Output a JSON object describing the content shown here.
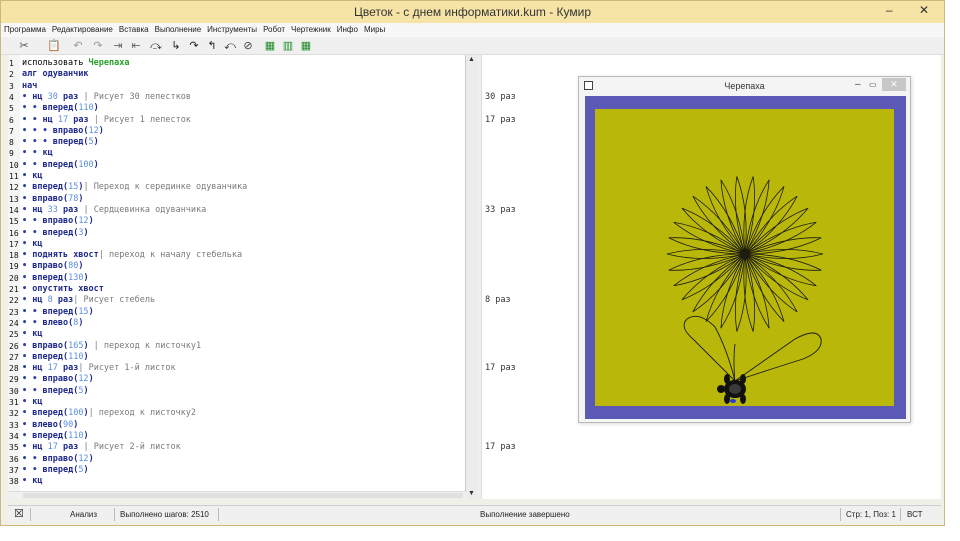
{
  "window": {
    "title": "Цветок - с днем информатики.kum - Кумир",
    "minimize": "–",
    "close": "✕"
  },
  "menu": [
    "Программа",
    "Редактирование",
    "Вставка",
    "Выполнение",
    "Инструменты",
    "Робот",
    "Чертежник",
    "Инфо",
    "Миры"
  ],
  "toolbar_icons": [
    "cut-icon",
    "paste-icon",
    "undo-icon",
    "redo-icon",
    "indent-icon",
    "unindent-icon",
    "step-icon",
    "step-in-icon",
    "step-over-icon",
    "step-out-icon",
    "return-icon",
    "stop-icon",
    "grid-one-icon",
    "grid-two-icon",
    "grid-four-icon"
  ],
  "code": [
    {
      "n": "1",
      "parts": [
        [
          "plain",
          "использовать "
        ],
        [
          "mod",
          "Черепаха"
        ]
      ]
    },
    {
      "n": "2",
      "parts": [
        [
          "kw",
          "алг одуванчик"
        ]
      ]
    },
    {
      "n": "3",
      "parts": [
        [
          "kw",
          "нач"
        ]
      ]
    },
    {
      "n": "4",
      "parts": [
        [
          "dot",
          "• "
        ],
        [
          "kw",
          "нц "
        ],
        [
          "num",
          "30"
        ],
        [
          "kw",
          " раз"
        ],
        [
          "cmt",
          " | Рисует 30 лепестков"
        ]
      ]
    },
    {
      "n": "5",
      "parts": [
        [
          "dot",
          "• • "
        ],
        [
          "kw",
          "вперед("
        ],
        [
          "num",
          "110"
        ],
        [
          "kw",
          ")"
        ]
      ]
    },
    {
      "n": "6",
      "parts": [
        [
          "dot",
          "• • "
        ],
        [
          "kw",
          "нц "
        ],
        [
          "num",
          "17"
        ],
        [
          "kw",
          " раз"
        ],
        [
          "cmt",
          " | Рисует 1 лепесток"
        ]
      ]
    },
    {
      "n": "7",
      "parts": [
        [
          "dot",
          "• • • "
        ],
        [
          "kw",
          "вправо("
        ],
        [
          "num",
          "12"
        ],
        [
          "kw",
          ")"
        ]
      ]
    },
    {
      "n": "8",
      "parts": [
        [
          "dot",
          "• • • "
        ],
        [
          "kw",
          "вперед("
        ],
        [
          "num",
          "5"
        ],
        [
          "kw",
          ")"
        ]
      ]
    },
    {
      "n": "9",
      "parts": [
        [
          "dot",
          "• • "
        ],
        [
          "kw",
          "кц"
        ]
      ]
    },
    {
      "n": "10",
      "parts": [
        [
          "dot",
          "• • "
        ],
        [
          "kw",
          "вперед("
        ],
        [
          "num",
          "100"
        ],
        [
          "kw",
          ")"
        ]
      ]
    },
    {
      "n": "11",
      "parts": [
        [
          "dot",
          "• "
        ],
        [
          "kw",
          "кц"
        ]
      ]
    },
    {
      "n": "12",
      "parts": [
        [
          "dot",
          "• "
        ],
        [
          "kw",
          "вперед("
        ],
        [
          "num",
          "15"
        ],
        [
          "kw",
          ")"
        ],
        [
          "cmt",
          "| Переход к серединке одуванчика"
        ]
      ]
    },
    {
      "n": "13",
      "parts": [
        [
          "dot",
          "• "
        ],
        [
          "kw",
          "вправо("
        ],
        [
          "num",
          "78"
        ],
        [
          "kw",
          ")"
        ]
      ]
    },
    {
      "n": "14",
      "parts": [
        [
          "dot",
          "• "
        ],
        [
          "kw",
          "нц "
        ],
        [
          "num",
          "33"
        ],
        [
          "kw",
          " раз"
        ],
        [
          "cmt",
          " | Сердцевинка одуванчика"
        ]
      ]
    },
    {
      "n": "15",
      "parts": [
        [
          "dot",
          "• • "
        ],
        [
          "kw",
          "вправо("
        ],
        [
          "num",
          "12"
        ],
        [
          "kw",
          ")"
        ]
      ]
    },
    {
      "n": "16",
      "parts": [
        [
          "dot",
          "• • "
        ],
        [
          "kw",
          "вперед("
        ],
        [
          "num",
          "3"
        ],
        [
          "kw",
          ")"
        ]
      ]
    },
    {
      "n": "17",
      "parts": [
        [
          "dot",
          "• "
        ],
        [
          "kw",
          "кц"
        ]
      ]
    },
    {
      "n": "18",
      "parts": [
        [
          "dot",
          "• "
        ],
        [
          "kw",
          "поднять хвост"
        ],
        [
          "cmt",
          "| переход к началу стебелька"
        ]
      ]
    },
    {
      "n": "19",
      "parts": [
        [
          "dot",
          "• "
        ],
        [
          "kw",
          "вправо("
        ],
        [
          "num",
          "80"
        ],
        [
          "kw",
          ")"
        ]
      ]
    },
    {
      "n": "20",
      "parts": [
        [
          "dot",
          "• "
        ],
        [
          "kw",
          "вперед("
        ],
        [
          "num",
          "130"
        ],
        [
          "kw",
          ")"
        ]
      ]
    },
    {
      "n": "21",
      "parts": [
        [
          "dot",
          "• "
        ],
        [
          "kw",
          "опустить хвост"
        ]
      ]
    },
    {
      "n": "22",
      "parts": [
        [
          "dot",
          "• "
        ],
        [
          "kw",
          "нц "
        ],
        [
          "num",
          "8"
        ],
        [
          "kw",
          " раз"
        ],
        [
          "cmt",
          "| Рисует стебель"
        ]
      ]
    },
    {
      "n": "23",
      "parts": [
        [
          "dot",
          "• • "
        ],
        [
          "kw",
          "вперед("
        ],
        [
          "num",
          "15"
        ],
        [
          "kw",
          ")"
        ]
      ]
    },
    {
      "n": "24",
      "parts": [
        [
          "dot",
          "• • "
        ],
        [
          "kw",
          "влево("
        ],
        [
          "num",
          "8"
        ],
        [
          "kw",
          ")"
        ]
      ]
    },
    {
      "n": "25",
      "parts": [
        [
          "dot",
          "• "
        ],
        [
          "kw",
          "кц"
        ]
      ]
    },
    {
      "n": "26",
      "parts": [
        [
          "dot",
          "• "
        ],
        [
          "kw",
          "вправо("
        ],
        [
          "num",
          "165"
        ],
        [
          "kw",
          ")"
        ],
        [
          "cmt",
          " | переход к листочку1"
        ]
      ]
    },
    {
      "n": "27",
      "parts": [
        [
          "dot",
          "• "
        ],
        [
          "kw",
          "вперед("
        ],
        [
          "num",
          "110"
        ],
        [
          "kw",
          ")"
        ]
      ]
    },
    {
      "n": "28",
      "parts": [
        [
          "dot",
          "• "
        ],
        [
          "kw",
          "нц "
        ],
        [
          "num",
          "17"
        ],
        [
          "kw",
          " раз"
        ],
        [
          "cmt",
          "| Рисует 1-й листок"
        ]
      ]
    },
    {
      "n": "29",
      "parts": [
        [
          "dot",
          "• • "
        ],
        [
          "kw",
          "вправо("
        ],
        [
          "num",
          "12"
        ],
        [
          "kw",
          ")"
        ]
      ]
    },
    {
      "n": "30",
      "parts": [
        [
          "dot",
          "• • "
        ],
        [
          "kw",
          "вперед("
        ],
        [
          "num",
          "5"
        ],
        [
          "kw",
          ")"
        ]
      ]
    },
    {
      "n": "31",
      "parts": [
        [
          "dot",
          "• "
        ],
        [
          "kw",
          "кц"
        ]
      ]
    },
    {
      "n": "32",
      "parts": [
        [
          "dot",
          "• "
        ],
        [
          "kw",
          "вперед("
        ],
        [
          "num",
          "100"
        ],
        [
          "kw",
          ")"
        ],
        [
          "cmt",
          "| переход к листочку2"
        ]
      ]
    },
    {
      "n": "33",
      "parts": [
        [
          "dot",
          "• "
        ],
        [
          "kw",
          "влево("
        ],
        [
          "num",
          "90"
        ],
        [
          "kw",
          ")"
        ]
      ]
    },
    {
      "n": "34",
      "parts": [
        [
          "dot",
          "• "
        ],
        [
          "kw",
          "вперед("
        ],
        [
          "num",
          "110"
        ],
        [
          "kw",
          ")"
        ]
      ]
    },
    {
      "n": "35",
      "parts": [
        [
          "dot",
          "• "
        ],
        [
          "kw",
          "нц "
        ],
        [
          "num",
          "17"
        ],
        [
          "kw",
          " раз"
        ],
        [
          "cmt",
          " | Рисует 2-й листок"
        ]
      ]
    },
    {
      "n": "36",
      "parts": [
        [
          "dot",
          "• • "
        ],
        [
          "kw",
          "вправо("
        ],
        [
          "num",
          "12"
        ],
        [
          "kw",
          ")"
        ]
      ]
    },
    {
      "n": "37",
      "parts": [
        [
          "dot",
          "• • "
        ],
        [
          "kw",
          "вперед("
        ],
        [
          "num",
          "5"
        ],
        [
          "kw",
          ")"
        ]
      ]
    },
    {
      "n": "38",
      "parts": [
        [
          "dot",
          "• "
        ],
        [
          "kw",
          "кц"
        ]
      ]
    }
  ],
  "margin_notes": [
    {
      "line": 4,
      "text": "30 раз"
    },
    {
      "line": 6,
      "text": "17 раз"
    },
    {
      "line": 14,
      "text": "33 раз"
    },
    {
      "line": 22,
      "text": "8 раз"
    },
    {
      "line": 28,
      "text": "17 раз"
    },
    {
      "line": 35,
      "text": "17 раз"
    }
  ],
  "turtle_window": {
    "title": "Черепаха",
    "minimize": "–",
    "maximize": "▭",
    "close": "✕"
  },
  "colors": {
    "field": "#b8b70a",
    "border": "#5c58b6",
    "keyword": "#1f2a8c",
    "number": "#5a8ee0",
    "comment": "#7a7a7a",
    "module": "#27a02a"
  },
  "status": {
    "analysis": "Анализ",
    "steps": "Выполнено шагов: 2510",
    "message": "Выполнение завершено",
    "position": "Стр: 1, Поз: 1",
    "mode": "ВСТ"
  }
}
